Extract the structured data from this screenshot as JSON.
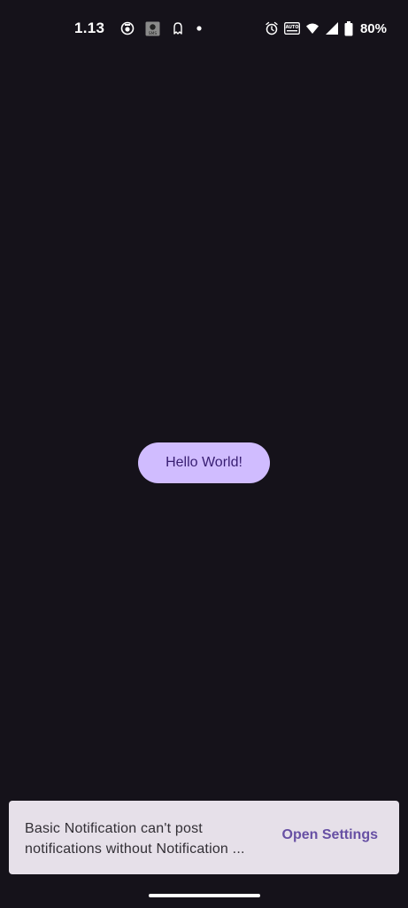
{
  "status_bar": {
    "time": "1.13",
    "battery_percent": "80%",
    "left_icons": [
      "bubble-icon",
      "sms-icon",
      "ghost-icon",
      "dot-icon"
    ],
    "right_icons": [
      "alarm-icon",
      "auto-brightness-icon",
      "wifi-icon",
      "signal-icon",
      "battery-icon"
    ],
    "sms_badge": "SMS",
    "auto_badge": "AUTO"
  },
  "main": {
    "button_label": "Hello World!"
  },
  "snackbar": {
    "message_line_1": "Basic Notification can't post",
    "message_line_2": "notifications without Notification ...",
    "action_label": "Open Settings"
  },
  "colors": {
    "background": "#15121a",
    "button_bg": "#d0bcff",
    "button_text": "#381e72",
    "snackbar_bg": "#e6e0e9",
    "snackbar_text": "#322f35",
    "snackbar_action": "#6750a4"
  }
}
